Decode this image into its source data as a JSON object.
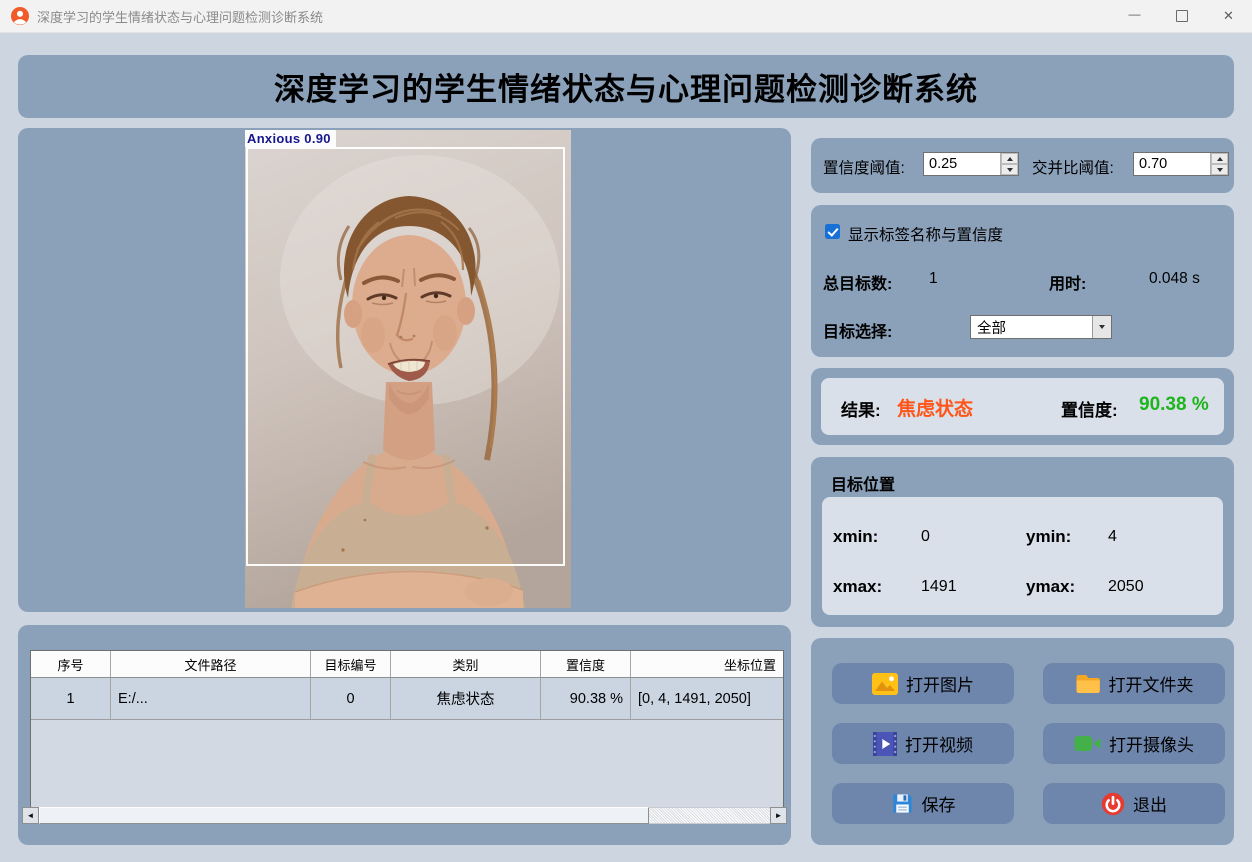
{
  "window": {
    "title": "深度学习的学生情绪状态与心理问题检测诊断系统",
    "minimize_glyph": "—",
    "close_glyph": "✕"
  },
  "banner": {
    "title": "深度学习的学生情绪状态与心理问题检测诊断系统"
  },
  "viewer": {
    "detection_label": "Anxious 0.90",
    "box_color": "#ffffff",
    "label_text_color": "#16168e"
  },
  "thresholds": {
    "confidence_label": "置信度阈值:",
    "confidence_value": "0.25",
    "iou_label": "交并比阈值:",
    "iou_value": "0.70"
  },
  "options": {
    "show_labels_text": "显示标签名称与置信度",
    "show_labels_checked": true,
    "total_label": "总目标数:",
    "total_value": "1",
    "time_label": "用时:",
    "time_value": "0.048 s",
    "select_label": "目标选择:",
    "select_value": "全部"
  },
  "result": {
    "label": "结果:",
    "value": "焦虑状态",
    "value_color": "#ff5519",
    "conf_label": "置信度:",
    "conf_value": "90.38 %",
    "conf_color": "#1db41d"
  },
  "position": {
    "title": "目标位置",
    "xmin_label": "xmin:",
    "xmin_value": "0",
    "ymin_label": "ymin:",
    "ymin_value": "4",
    "xmax_label": "xmax:",
    "xmax_value": "1491",
    "ymax_label": "ymax:",
    "ymax_value": "2050"
  },
  "actions": {
    "open_image": "打开图片",
    "open_folder": "打开文件夹",
    "open_video": "打开视频",
    "open_camera": "打开摄像头",
    "save": "保存",
    "exit": "退出"
  },
  "table": {
    "headers": [
      "序号",
      "文件路径",
      "目标编号",
      "类别",
      "置信度",
      "坐标位置"
    ],
    "rows": [
      [
        "1",
        "E:/...",
        "0",
        "焦虑状态",
        "90.38 %",
        "[0, 4, 1491, 2050]"
      ]
    ]
  },
  "scrollbar": {
    "left_glyph": "◄",
    "right_glyph": "►"
  }
}
